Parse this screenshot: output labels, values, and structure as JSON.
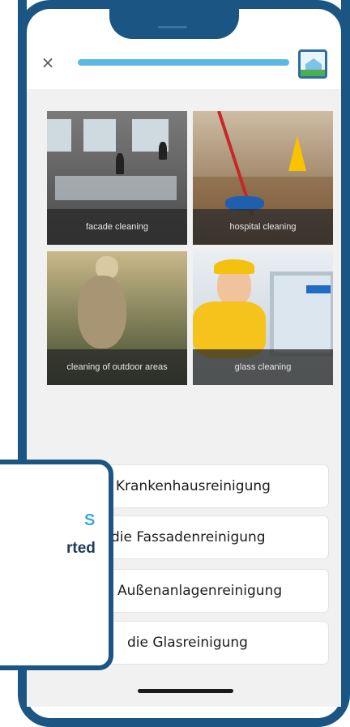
{
  "header": {
    "close_glyph": "×",
    "progress_fraction": 0.95,
    "logo_icon": "house-app-icon"
  },
  "tiles": [
    {
      "caption": "facade cleaning"
    },
    {
      "caption": "hospital cleaning"
    },
    {
      "caption": "cleaning of outdoor areas"
    },
    {
      "caption": "glass cleaning"
    }
  ],
  "answers": [
    {
      "label": "e Krankenhausreinigung"
    },
    {
      "label": "die Fassadenreinigung"
    },
    {
      "label": "Außenanlagenreinigung"
    },
    {
      "label": "die Glasreinigung"
    }
  ],
  "overlay": {
    "line1": "S",
    "line2": "rted"
  },
  "colors": {
    "frame": "#1a5584",
    "progress": "#5bb8e3",
    "accent": "#3fa9e0"
  }
}
